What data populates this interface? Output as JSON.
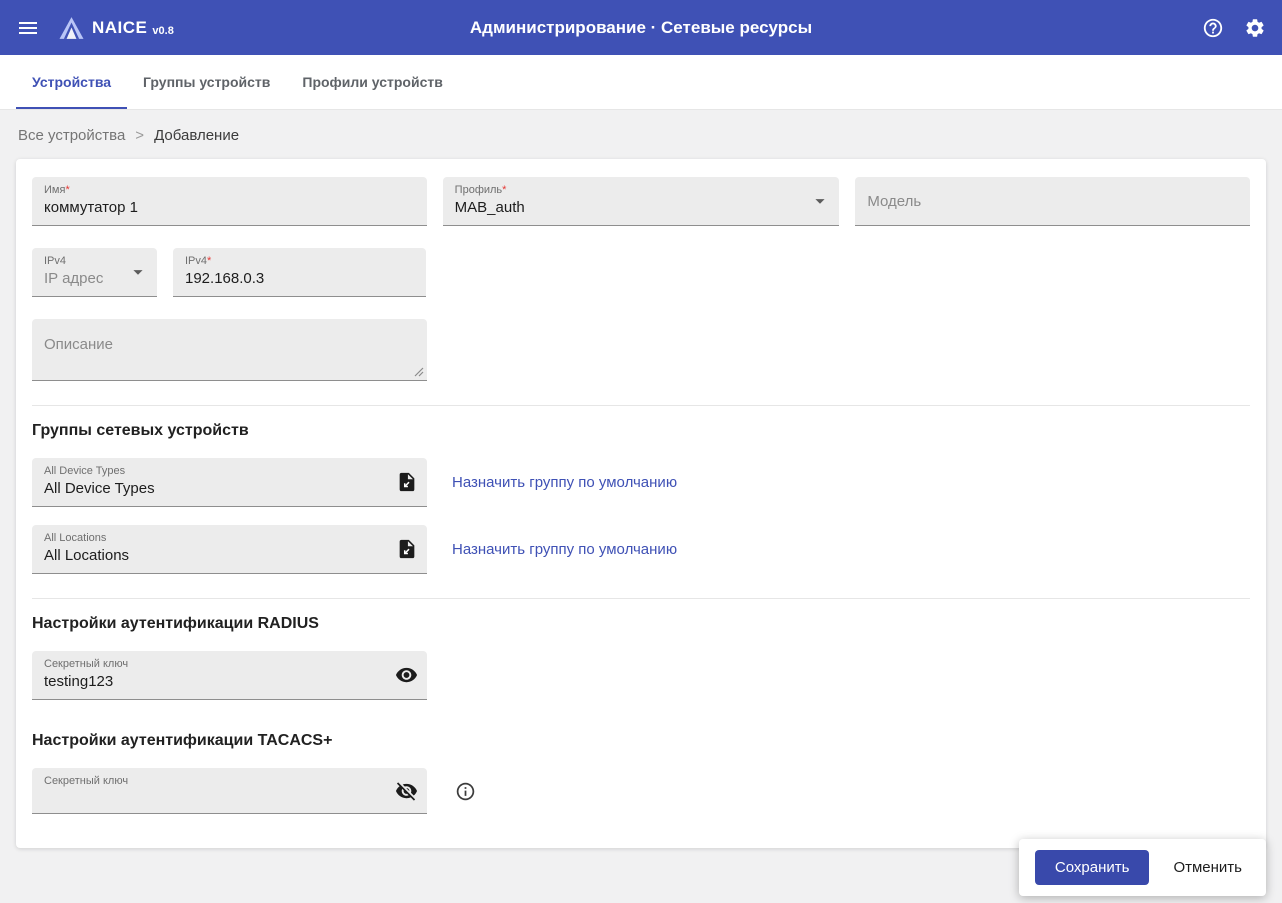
{
  "topbar": {
    "app_name": "NAICE",
    "app_version": "v0.8",
    "title": "Администрирование · Сетевые ресурсы"
  },
  "tabs": [
    {
      "label": "Устройства",
      "active": true
    },
    {
      "label": "Группы устройств",
      "active": false
    },
    {
      "label": "Профили устройств",
      "active": false
    }
  ],
  "breadcrumb": {
    "root": "Все устройства",
    "separator": ">",
    "current": "Добавление"
  },
  "form": {
    "name": {
      "label": "Имя",
      "required_mark": "*",
      "value": "коммутатор 1"
    },
    "profile": {
      "label": "Профиль",
      "required_mark": "*",
      "value": "MAB_auth"
    },
    "model": {
      "placeholder": "Модель"
    },
    "ip_type": {
      "label": "IPv4",
      "value": "IP адрес"
    },
    "ip_address": {
      "label": "IPv4",
      "required_mark": "*",
      "value": "192.168.0.3"
    },
    "description": {
      "placeholder": "Описание"
    }
  },
  "groups": {
    "title": "Группы сетевых устройств",
    "items": [
      {
        "label": "All Device Types",
        "value": "All Device Types",
        "link_label": "Назначить группу по умолчанию"
      },
      {
        "label": "All Locations",
        "value": "All Locations",
        "link_label": "Назначить группу по умолчанию"
      }
    ]
  },
  "radius": {
    "title": "Настройки аутентификации RADIUS",
    "secret": {
      "label": "Секретный ключ",
      "value": "testing123"
    }
  },
  "tacacs": {
    "title": "Настройки аутентификации TACACS+",
    "secret": {
      "label": "Секретный ключ",
      "value": ""
    }
  },
  "actions": {
    "save_label": "Сохранить",
    "cancel_label": "Отменить"
  },
  "colors": {
    "primary": "#3f51b5",
    "button": "#3949ab",
    "link": "#3f51b5",
    "required": "#e53935"
  }
}
